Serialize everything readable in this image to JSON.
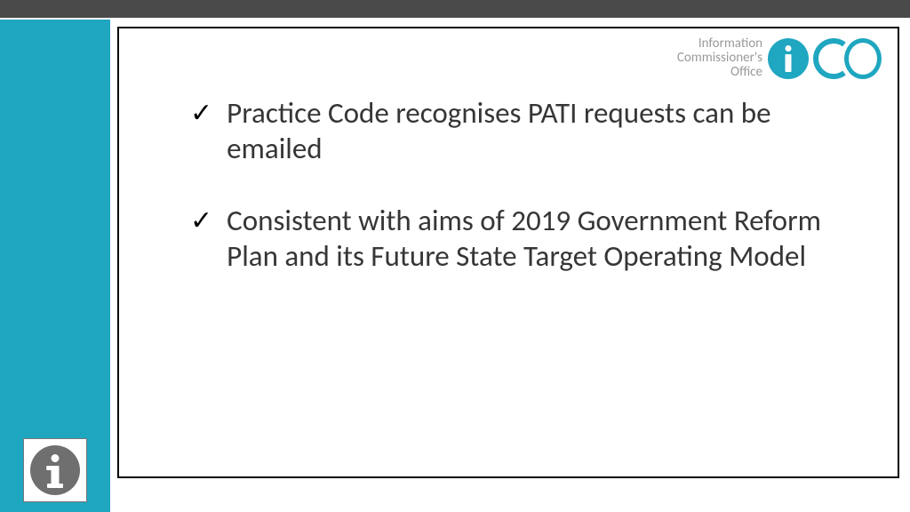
{
  "topbar": {},
  "logo": {
    "line1": "Information",
    "line2": "Commissioner's",
    "line3": "Office"
  },
  "bullets": [
    "Practice Code recognises PATI requests can be emailed",
    "Consistent with aims of 2019 Government Reform Plan and its Future State Target Operating Model"
  ],
  "colors": {
    "accent": "#1fa6c0",
    "topbar": "#4a4a4a",
    "text": "#363636",
    "logoText": "#9a9a9a",
    "infoGrey": "#6f6f6f"
  }
}
